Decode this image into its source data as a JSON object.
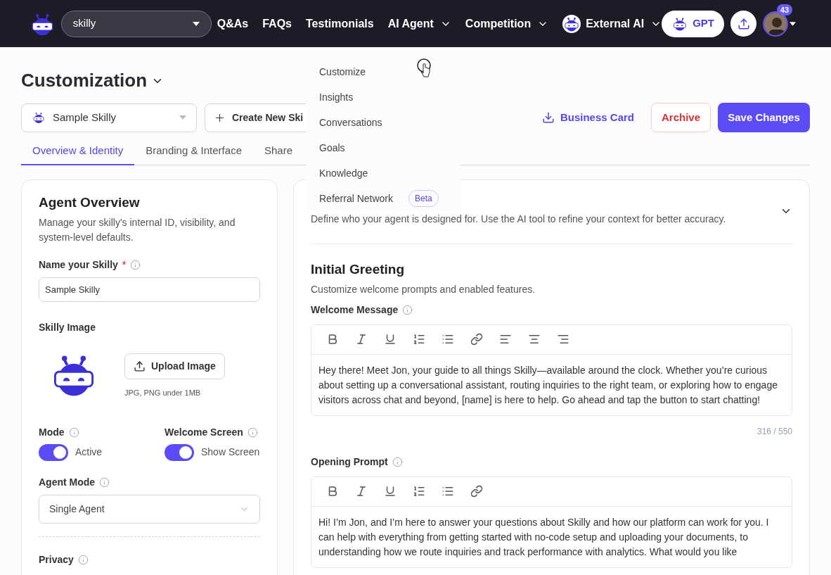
{
  "nav": {
    "search": {
      "value": "skilly"
    },
    "links": [
      {
        "label": "Q&As",
        "dropdown": false,
        "kind": "plain"
      },
      {
        "label": "FAQs",
        "dropdown": false,
        "kind": "plain"
      },
      {
        "label": "Testimonials",
        "dropdown": false,
        "kind": "plain"
      },
      {
        "label": "AI Agent",
        "dropdown": true,
        "kind": "plain"
      },
      {
        "label": "Competition",
        "dropdown": true,
        "kind": "plain"
      },
      {
        "label": "External AI",
        "dropdown": true,
        "kind": "logo"
      }
    ],
    "gpt_button": "GPT",
    "notification_count": "43"
  },
  "header": {
    "title": "Customization",
    "skilly_select": "Sample Skilly",
    "create_button": "Create New Ski",
    "business_card": "Business Card",
    "archive": "Archive",
    "save": "Save Changes"
  },
  "tabs": [
    {
      "label": "Overview & Identity",
      "selected": true
    },
    {
      "label": "Branding & Interface",
      "selected": false
    },
    {
      "label": "Share",
      "selected": false
    }
  ],
  "menu": [
    {
      "label": "Customize"
    },
    {
      "label": "Insights"
    },
    {
      "label": "Conversations"
    },
    {
      "label": "Goals"
    },
    {
      "label": "Knowledge"
    },
    {
      "label": "Referral Network",
      "badge": "Beta"
    }
  ],
  "overview": {
    "title": "Agent Overview",
    "description": "Manage your skilly's internal ID, visibility, and system-level defaults.",
    "name_label": "Name your Skilly",
    "name_required": "*",
    "name_value": "Sample Skilly",
    "image_label": "Skilly Image",
    "upload_button": "Upload Image",
    "upload_hint": "JPG, PNG under 1MB",
    "switches": [
      {
        "label": "Mode",
        "on": true,
        "state_text": "Active"
      },
      {
        "label": "Welcome Screen",
        "on": true,
        "state_text": "Show Screen"
      }
    ],
    "agent_mode_label": "Agent Mode",
    "agent_mode_value": "Single Agent",
    "privacy_label": "Privacy"
  },
  "context": {
    "description": "Define who your agent is designed for. Use the AI tool to refine your context for better accuracy."
  },
  "greeting": {
    "title": "Initial Greeting",
    "description": "Customize welcome prompts and enabled features.",
    "editors": [
      {
        "label": "Welcome Message",
        "toolbar": [
          {
            "kind": "bold"
          },
          {
            "kind": "italic"
          },
          {
            "kind": "underline"
          },
          {
            "kind": "ordered-list"
          },
          {
            "kind": "bullet-list"
          },
          {
            "kind": "link"
          },
          {
            "kind": "align-left"
          },
          {
            "kind": "align-center"
          },
          {
            "kind": "align-right"
          }
        ],
        "text": "Hey there! Meet Jon, your guide to all things Skilly—available around the clock. Whether you’re curious about setting up a conversational assistant, routing inquiries to the right team, or exploring how to engage visitors across chat and beyond, [name] is here to help. Go ahead and tap the button to start chatting!",
        "counter": "316 / 550"
      },
      {
        "label": "Opening Prompt",
        "toolbar": [
          {
            "kind": "bold"
          },
          {
            "kind": "italic"
          },
          {
            "kind": "underline"
          },
          {
            "kind": "ordered-list"
          },
          {
            "kind": "bullet-list"
          },
          {
            "kind": "link"
          }
        ],
        "text": "Hi! I’m Jon, and I’m here to answer your questions about Skilly and how our platform can work for you. I can help with everything from getting started with no-code setup and uploading your documents, to understanding how we route inquiries and track performance with analytics. What would you like"
      }
    ]
  }
}
